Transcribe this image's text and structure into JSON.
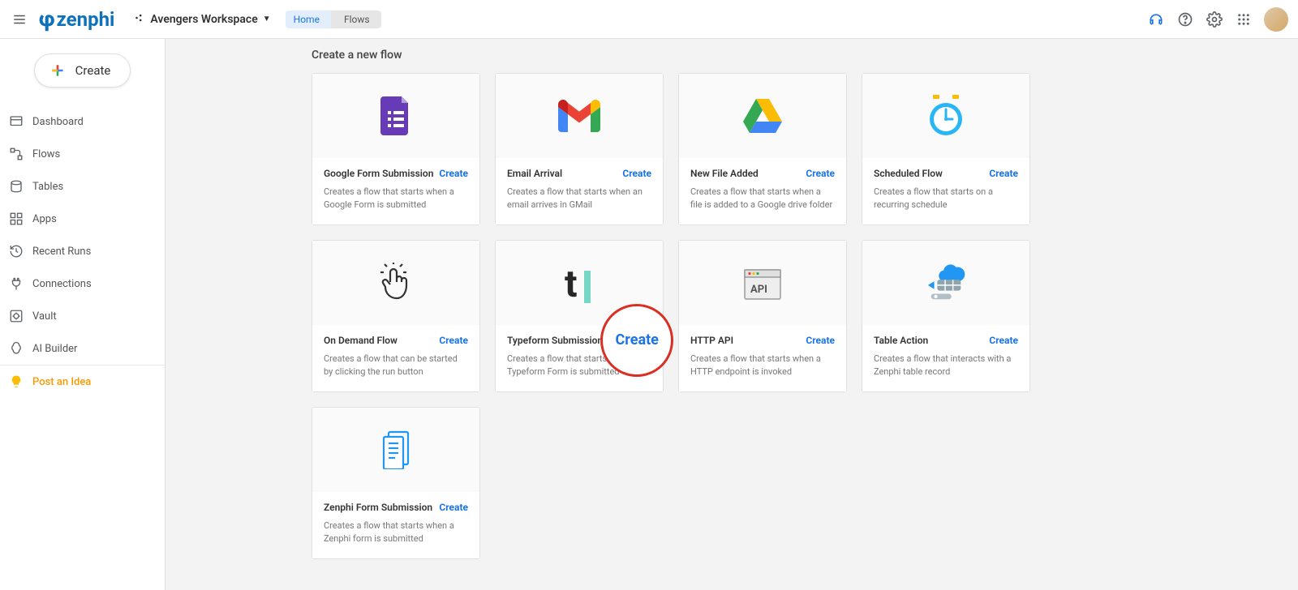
{
  "header": {
    "logo_text": "zenphi",
    "workspace": "Avengers Workspace",
    "breadcrumb": {
      "home": "Home",
      "current": "Flows"
    }
  },
  "sidebar": {
    "create_label": "Create",
    "items": [
      {
        "label": "Dashboard",
        "icon": "dashboard"
      },
      {
        "label": "Flows",
        "icon": "flows"
      },
      {
        "label": "Tables",
        "icon": "tables"
      },
      {
        "label": "Apps",
        "icon": "apps"
      },
      {
        "label": "Recent Runs",
        "icon": "recent"
      },
      {
        "label": "Connections",
        "icon": "connections"
      },
      {
        "label": "Vault",
        "icon": "vault"
      },
      {
        "label": "AI Builder",
        "icon": "ai"
      }
    ],
    "post_idea": "Post an Idea"
  },
  "main": {
    "title": "Create a new flow",
    "create_label": "Create",
    "cards": [
      {
        "title": "Google Form Submission",
        "desc": "Creates a flow that starts when a Google Form is submitted",
        "icon": "gform"
      },
      {
        "title": "Email Arrival",
        "desc": "Creates a flow that starts when an email arrives in GMail",
        "icon": "gmail"
      },
      {
        "title": "New File Added",
        "desc": "Creates a flow that starts when a file is added to a Google drive folder",
        "icon": "gdrive"
      },
      {
        "title": "Scheduled Flow",
        "desc": "Creates a flow that starts on a recurring schedule",
        "icon": "clock"
      },
      {
        "title": "On Demand Flow",
        "desc": "Creates a flow that can be started by clicking the run button",
        "icon": "tap"
      },
      {
        "title": "Typeform Submission",
        "desc": "Creates a flow that starts when a Typeform Form is submitted",
        "icon": "typeform"
      },
      {
        "title": "HTTP API",
        "desc": "Creates a flow that starts when a HTTP endpoint is invoked",
        "icon": "api"
      },
      {
        "title": "Table Action",
        "desc": "Creates a flow that interacts with a Zenphi table record",
        "icon": "tableaction"
      },
      {
        "title": "Zenphi Form Submission",
        "desc": "Creates a flow that starts when a Zenphi form is submitted",
        "icon": "zform"
      }
    ],
    "highlight_label": "Create"
  }
}
